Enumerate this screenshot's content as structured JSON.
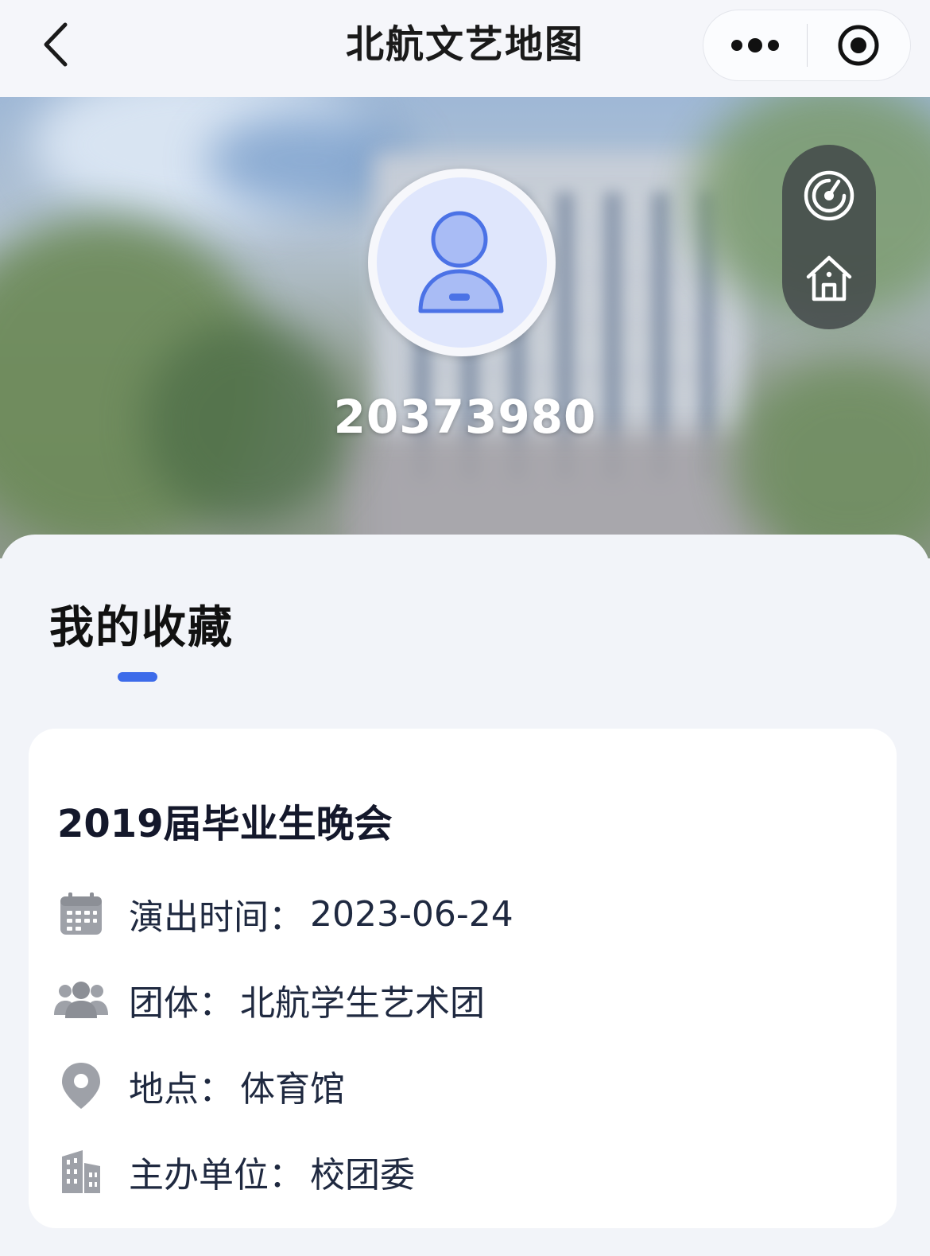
{
  "navbar": {
    "title": "北航文艺地图",
    "back_icon": "chevron-left-icon",
    "more_icon": "more-dots-icon",
    "close_icon": "target-circle-icon"
  },
  "profile": {
    "user_id": "20373980",
    "avatar_icon": "user-avatar-icon"
  },
  "side_actions": [
    {
      "icon": "radar-icon"
    },
    {
      "icon": "home-icon"
    }
  ],
  "favorites": {
    "title": "我的收藏",
    "accent_color": "#3d6bea",
    "items": [
      {
        "title": "2019届毕业生晚会",
        "rows": [
          {
            "icon": "calendar-icon",
            "label": "演出时间：",
            "value": "2023-06-24"
          },
          {
            "icon": "group-icon",
            "label": "团体：",
            "value": "北航学生艺术团"
          },
          {
            "icon": "location-pin-icon",
            "label": "地点：",
            "value": "体育馆"
          },
          {
            "icon": "building-icon",
            "label": "主办单位：",
            "value": "校团委"
          }
        ]
      }
    ]
  }
}
